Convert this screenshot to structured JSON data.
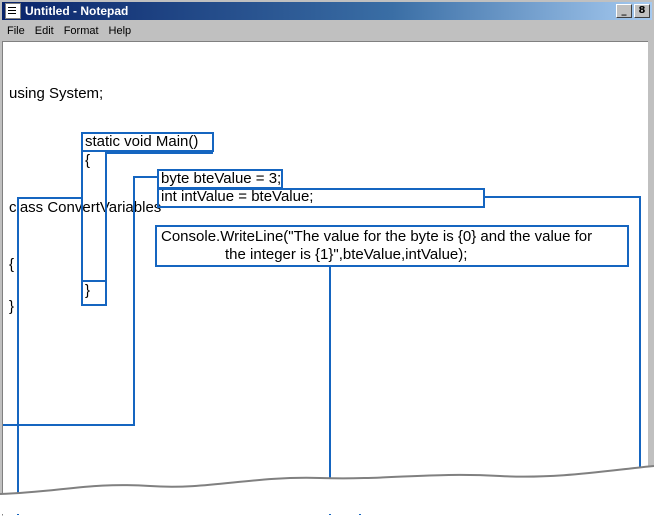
{
  "window": {
    "title": "Untitled - Notepad",
    "controls": {
      "minimize": "_",
      "maximize": "8"
    }
  },
  "menu": {
    "items": [
      "File",
      "Edit",
      "Format",
      "Help"
    ]
  },
  "code": {
    "lines": [
      "using System;",
      "",
      "class ConvertVariables",
      "{"
    ],
    "main_signature": "static void Main()",
    "open_brace": "{",
    "byte_decl": "byte bteValue = 3;",
    "int_decl": "int intValue = bteValue;",
    "console_line1": "Console.WriteLine(\"The value for the byte is {0} and the value for",
    "console_line2": "the integer is {1}\",bteValue,intValue);",
    "close_brace_main": "}",
    "close_brace_class": "}"
  },
  "colors": {
    "annotation": "#1565c0",
    "titlebar_start": "#0a246a",
    "titlebar_end": "#a6caf0"
  },
  "icons": {
    "app": "notepad-icon",
    "scroll_left": "arrow-left-icon"
  }
}
